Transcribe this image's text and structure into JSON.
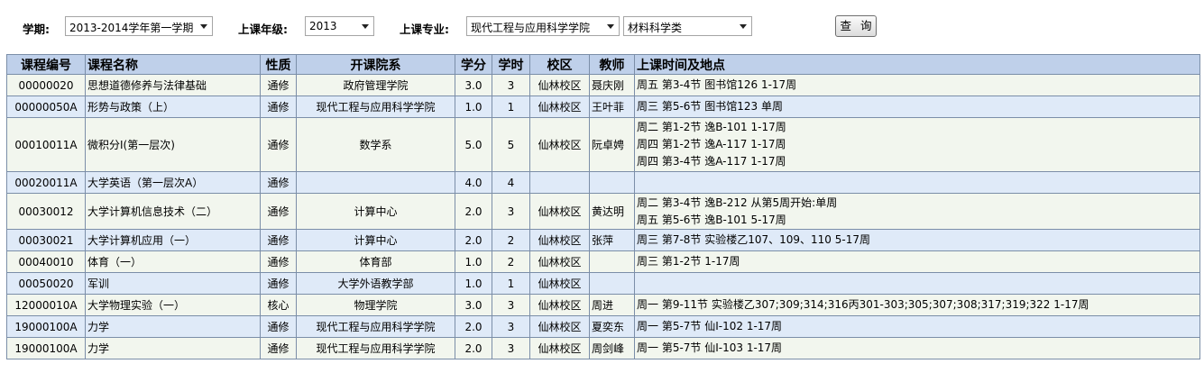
{
  "filters": {
    "term_label": "学期:",
    "term_value": "2013-2014学年第一学期",
    "grade_label": "上课年级:",
    "grade_value": "2013",
    "major_label": "上课专业:",
    "school_value": "现代工程与应用科学学院",
    "major_value": "材料科学类",
    "query_label": "查 询"
  },
  "table": {
    "headers": [
      "课程编号",
      "课程名称",
      "性质",
      "开课院系",
      "学分",
      "学时",
      "校区",
      "教师",
      "上课时间及地点"
    ],
    "rows": [
      {
        "code": "00000020",
        "name": "思想道德修养与法律基础",
        "type": "通修",
        "dept": "政府管理学院",
        "credit": "3.0",
        "hours": "3",
        "campus": "仙林校区",
        "teacher": "聂庆刚",
        "times": [
          "周五 第3-4节 图书馆126 1-17周"
        ]
      },
      {
        "code": "00000050A",
        "name": "形势与政策（上）",
        "type": "通修",
        "dept": "现代工程与应用科学学院",
        "credit": "1.0",
        "hours": "1",
        "campus": "仙林校区",
        "teacher": "王叶菲",
        "times": [
          "周三 第5-6节 图书馆123 单周"
        ]
      },
      {
        "code": "00010011A",
        "name": "微积分I(第一层次)",
        "type": "通修",
        "dept": "数学系",
        "credit": "5.0",
        "hours": "5",
        "campus": "仙林校区",
        "teacher": "阮卓娉",
        "times": [
          "周二 第1-2节 逸B-101 1-17周",
          "周四 第1-2节 逸A-117 1-17周",
          "周四 第3-4节 逸A-117 1-17周"
        ]
      },
      {
        "code": "00020011A",
        "name": "大学英语（第一层次A）",
        "type": "通修",
        "dept": "",
        "credit": "4.0",
        "hours": "4",
        "campus": "",
        "teacher": "",
        "times": []
      },
      {
        "code": "00030012",
        "name": "大学计算机信息技术（二）",
        "type": "通修",
        "dept": "计算中心",
        "credit": "2.0",
        "hours": "3",
        "campus": "仙林校区",
        "teacher": "黄达明",
        "times": [
          "周二 第3-4节 逸B-212 从第5周开始:单周",
          "周五 第5-6节 逸B-101 5-17周"
        ]
      },
      {
        "code": "00030021",
        "name": "大学计算机应用（一）",
        "type": "通修",
        "dept": "计算中心",
        "credit": "2.0",
        "hours": "2",
        "campus": "仙林校区",
        "teacher": "张萍",
        "times": [
          "周三 第7-8节 实验楼乙107、109、110 5-17周"
        ]
      },
      {
        "code": "00040010",
        "name": "体育（一）",
        "type": "通修",
        "dept": "体育部",
        "credit": "1.0",
        "hours": "2",
        "campus": "仙林校区",
        "teacher": "",
        "times": [
          "周三 第1-2节  1-17周"
        ]
      },
      {
        "code": "00050020",
        "name": "军训",
        "type": "通修",
        "dept": "大学外语教学部",
        "credit": "1.0",
        "hours": "1",
        "campus": "仙林校区",
        "teacher": "",
        "times": []
      },
      {
        "code": "12000010A",
        "name": "大学物理实验（一）",
        "type": "核心",
        "dept": "物理学院",
        "credit": "3.0",
        "hours": "3",
        "campus": "仙林校区",
        "teacher": "周进",
        "times": [
          "周一 第9-11节 实验楼乙307;309;314;316丙301-303;305;307;308;317;319;322 1-17周"
        ]
      },
      {
        "code": "19000100A",
        "name": "力学",
        "type": "通修",
        "dept": "现代工程与应用科学学院",
        "credit": "2.0",
        "hours": "3",
        "campus": "仙林校区",
        "teacher": "夏奕东",
        "times": [
          "周一 第5-7节 仙Ⅰ-102 1-17周"
        ]
      },
      {
        "code": "19000100A",
        "name": "力学",
        "type": "通修",
        "dept": "现代工程与应用科学学院",
        "credit": "2.0",
        "hours": "3",
        "campus": "仙林校区",
        "teacher": "周剑峰",
        "times": [
          "周一 第5-7节 仙Ⅰ-103 1-17周"
        ]
      }
    ]
  }
}
